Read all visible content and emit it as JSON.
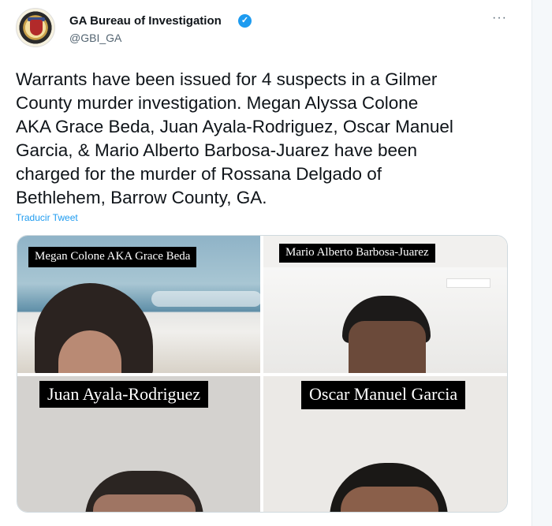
{
  "author": {
    "name": "GA Bureau of Investigation",
    "handle": "@GBI_GA",
    "verified_icon": "verified-badge-icon",
    "avatar": "gbi-seal-logo"
  },
  "more_options": "···",
  "tweet": {
    "text": "Warrants have been issued for 4 suspects in a Gilmer\nCounty murder investigation.  Megan Alyssa Colone\nAKA Grace Beda, Juan Ayala-Rodriguez, Oscar Manuel\nGarcia, & Mario Alberto Barbosa-Juarez have been\ncharged for the murder of Rossana Delgado of\nBethlehem, Barrow County, GA.",
    "translate_label": "Traducir Tweet"
  },
  "media": {
    "photos": [
      {
        "label": "Megan Colone AKA Grace Beda"
      },
      {
        "label": "Mario Alberto Barbosa-Juarez"
      },
      {
        "label": "Juan Ayala-Rodriguez"
      },
      {
        "label": "Oscar Manuel Garcia"
      }
    ]
  },
  "colors": {
    "accent": "#1d9bf0",
    "text": "#0f1419",
    "secondary": "#536471"
  }
}
